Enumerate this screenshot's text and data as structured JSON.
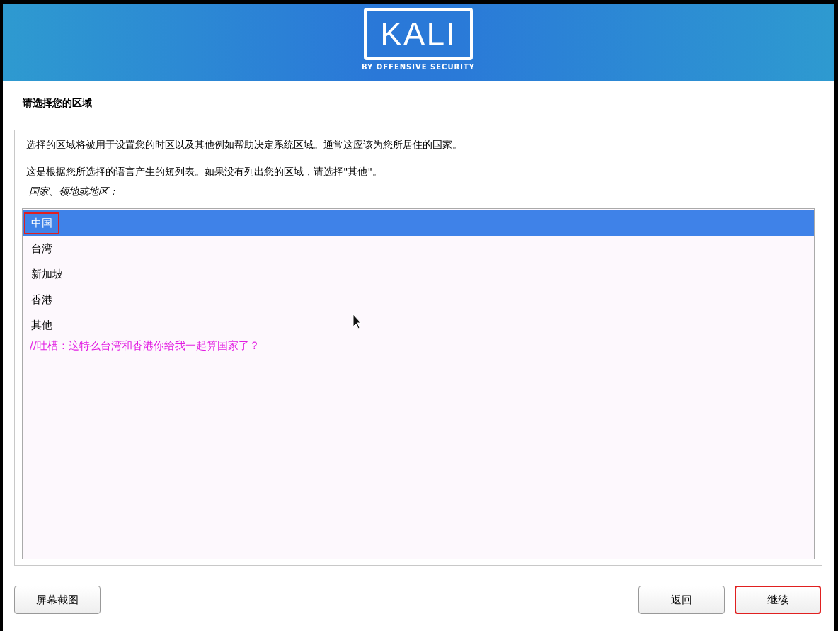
{
  "banner": {
    "logo": "KALI",
    "tagline": "BY OFFENSIVE SECURITY"
  },
  "title": "请选择您的区域",
  "description": [
    "选择的区域将被用于设置您的时区以及其他例如帮助决定系统区域。通常这应该为您所居住的国家。",
    "这是根据您所选择的语言产生的短列表。如果没有列出您的区域，请选择\"其他\"。"
  ],
  "list_label": "国家、领地或地区：",
  "list": {
    "items": [
      {
        "label": "中国",
        "selected": true,
        "annotated": true
      },
      {
        "label": "台湾",
        "selected": false,
        "annotated": false
      },
      {
        "label": "新加坡",
        "selected": false,
        "annotated": false
      },
      {
        "label": "香港",
        "selected": false,
        "annotated": false
      },
      {
        "label": "其他",
        "selected": false,
        "annotated": false
      }
    ],
    "comment": "//吐槽：这特么台湾和香港你给我一起算国家了？"
  },
  "buttons": [
    {
      "label": "屏幕截图",
      "annotated": false
    },
    {
      "label": "返回",
      "annotated": false
    },
    {
      "label": "继续",
      "annotated": true
    }
  ]
}
